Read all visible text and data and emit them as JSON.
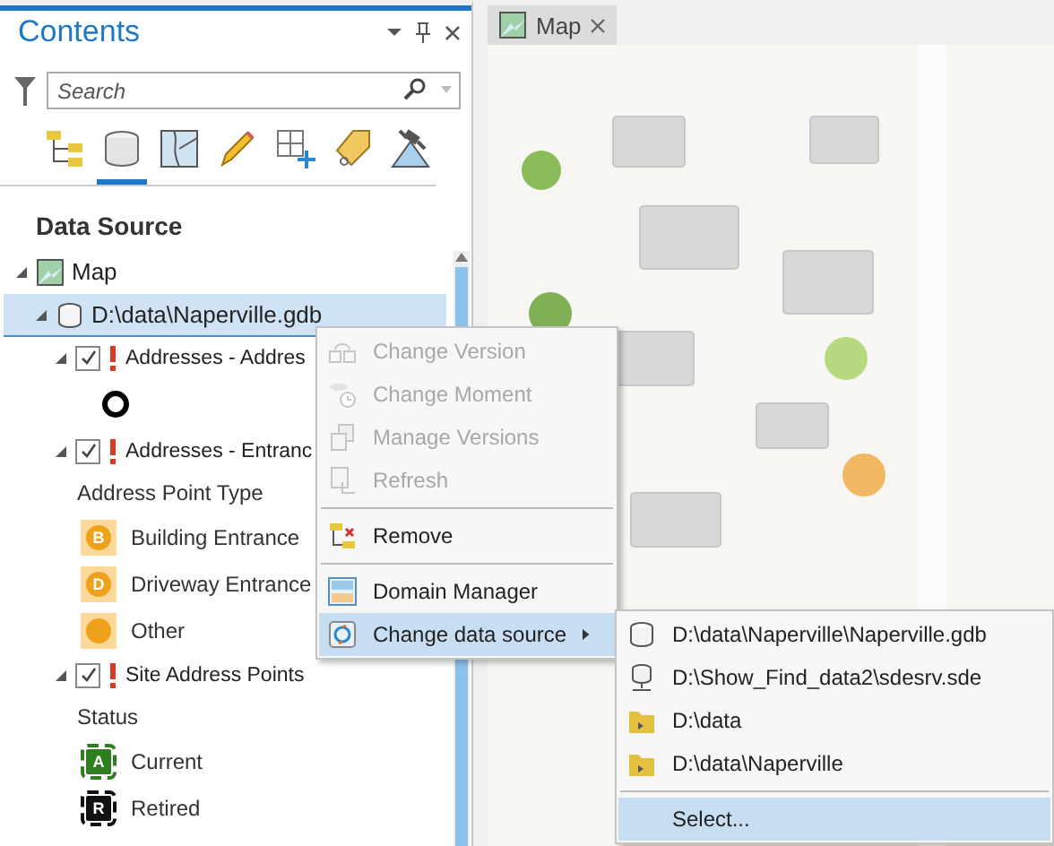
{
  "pane": {
    "title": "Contents"
  },
  "search": {
    "placeholder": "Search"
  },
  "view_tabs": [
    {
      "kind": "drawing-order",
      "selected": false
    },
    {
      "kind": "data-source",
      "selected": true
    },
    {
      "kind": "selection",
      "selected": false
    },
    {
      "kind": "editing",
      "selected": false
    },
    {
      "kind": "snapping",
      "selected": false
    },
    {
      "kind": "labeling",
      "selected": false
    },
    {
      "kind": "perspective",
      "selected": false
    }
  ],
  "section_title": "Data Source",
  "tree": [
    {
      "label": "Map",
      "kind": "map",
      "expanded": true,
      "selected": false,
      "children": [
        {
          "label": "D:\\data\\Naperville.gdb",
          "kind": "database",
          "expanded": true,
          "selected": true,
          "children": [
            {
              "label": "Addresses - Addres",
              "kind": "layer",
              "expanded": true,
              "selected": false,
              "checked": true,
              "warning": true,
              "legend": [
                {
                  "kind": "ring"
                }
              ]
            },
            {
              "label": "Addresses - Entranc",
              "kind": "layer",
              "expanded": true,
              "selected": false,
              "checked": true,
              "warning": true,
              "legend_title": "Address Point Type",
              "legend": [
                {
                  "kind": "circle",
                  "letter": "B",
                  "label": "Building Entrance",
                  "color": "#eea21b"
                },
                {
                  "kind": "circle",
                  "letter": "D",
                  "label": "Driveway Entrance",
                  "color": "#eea21b"
                },
                {
                  "kind": "circle",
                  "label": "Other",
                  "color": "#eea21b"
                }
              ]
            },
            {
              "label": "Site Address Points",
              "kind": "layer",
              "expanded": true,
              "selected": false,
              "checked": true,
              "warning": true,
              "legend_title": "Status",
              "legend": [
                {
                  "kind": "square",
                  "letter": "A",
                  "label": "Current",
                  "color": "#2e7d1f"
                },
                {
                  "kind": "square",
                  "letter": "R",
                  "label": "Retired",
                  "color": "#111111"
                }
              ]
            }
          ]
        }
      ]
    }
  ],
  "map_tab": {
    "title": "Map"
  },
  "context_menu": [
    {
      "kind": "item",
      "label": "Change Version",
      "disabled": true,
      "selected": false
    },
    {
      "kind": "item",
      "label": "Change Moment",
      "disabled": true,
      "selected": false
    },
    {
      "kind": "item",
      "label": "Manage Versions",
      "disabled": true,
      "selected": false
    },
    {
      "kind": "item",
      "label": "Refresh",
      "disabled": true,
      "selected": false
    },
    {
      "kind": "separator"
    },
    {
      "kind": "item",
      "label": "Remove",
      "disabled": false,
      "selected": false
    },
    {
      "kind": "separator"
    },
    {
      "kind": "item",
      "label": "Domain Manager",
      "disabled": false,
      "selected": false
    },
    {
      "kind": "item",
      "label": "Change data source",
      "disabled": false,
      "selected": true,
      "has_submenu": true
    }
  ],
  "submenu": [
    {
      "kind": "item",
      "label": "D:\\data\\Naperville\\Naperville.gdb",
      "selected": false
    },
    {
      "kind": "item",
      "label": "D:\\Show_Find_data2\\sdesrv.sde",
      "selected": false
    },
    {
      "kind": "item",
      "label": "D:\\data",
      "selected": false
    },
    {
      "kind": "item",
      "label": "D:\\data\\Naperville",
      "selected": false
    },
    {
      "kind": "separator"
    },
    {
      "kind": "item",
      "label": "Select...",
      "selected": true
    }
  ]
}
